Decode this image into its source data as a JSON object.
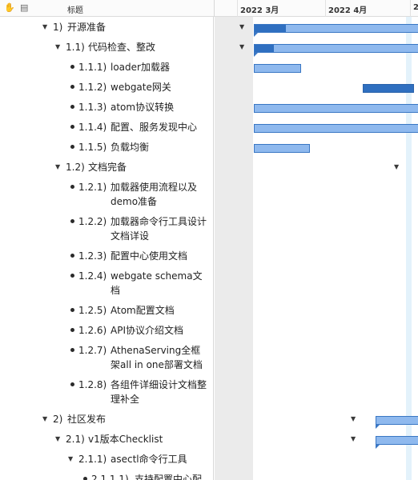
{
  "header": {
    "title_column": "标题",
    "months": [
      "2022 3月",
      "2022 4月",
      "2"
    ],
    "icons": [
      "hand-icon",
      "document-icon"
    ]
  },
  "colors": {
    "bar_fill": "#8fb9ee",
    "bar_progress": "#2f6fc0",
    "today_line": "#e3f2fb"
  },
  "rows": [
    {
      "level": 1,
      "marker": "triangle",
      "num": "1)",
      "text": "开源准备",
      "chart": {
        "type": "summary",
        "start": 0.0,
        "end": 1.1,
        "progress": 0.16
      }
    },
    {
      "level": 2,
      "marker": "triangle",
      "num": "1.1)",
      "text": "代码检查、整改",
      "chart": {
        "type": "summary",
        "start": 0.0,
        "end": 1.1,
        "progress": 0.1
      }
    },
    {
      "level": 3,
      "marker": "bullet",
      "num": "1.1.1)",
      "text": "loader加载器",
      "chart": {
        "type": "bar",
        "start": 0.0,
        "end": 0.27,
        "progress": 0
      }
    },
    {
      "level": 3,
      "marker": "bullet",
      "num": "1.1.2)",
      "text": "webgate网关",
      "chart": {
        "type": "bar",
        "start": 0.62,
        "end": 0.91,
        "progress": 1
      }
    },
    {
      "level": 3,
      "marker": "bullet",
      "num": "1.1.3)",
      "text": "atom协议转换",
      "chart": {
        "type": "bar",
        "start": 0.0,
        "end": 1.1,
        "progress": 0
      }
    },
    {
      "level": 3,
      "marker": "bullet",
      "num": "1.1.4)",
      "text": "配置、服务发现中心",
      "chart": {
        "type": "bar",
        "start": 0.0,
        "end": 1.1,
        "progress": 0
      }
    },
    {
      "level": 3,
      "marker": "bullet",
      "num": "1.1.5)",
      "text": "负载均衡",
      "chart": {
        "type": "bar",
        "start": 0.0,
        "end": 0.32,
        "progress": 0
      }
    },
    {
      "level": 2,
      "marker": "triangle",
      "num": "1.2)",
      "text": "文档完备",
      "chart": {
        "type": "summary",
        "start": 0.93,
        "end": 1.1,
        "progress": 0
      }
    },
    {
      "level": 3,
      "marker": "bullet",
      "num": "1.2.1)",
      "text": "加载器使用流程以及demo准备",
      "chart": {
        "type": "bar",
        "start": 0.93,
        "end": 1.1,
        "progress": 0
      }
    },
    {
      "level": 3,
      "marker": "bullet",
      "num": "1.2.2)",
      "text": "加载器命令行工具设计文档详设",
      "chart": {
        "type": "bar",
        "start": 0.93,
        "end": 1.1,
        "progress": 0
      }
    },
    {
      "level": 3,
      "marker": "bullet",
      "num": "1.2.3)",
      "text": "配置中心使用文档",
      "chart": {
        "type": "empty",
        "start": 0.93,
        "end": 1.1,
        "progress": 0
      }
    },
    {
      "level": 3,
      "marker": "bullet",
      "num": "1.2.4)",
      "text": "webgate schema文档",
      "chart": {
        "type": "empty",
        "start": 0.93,
        "end": 1.1,
        "progress": 0
      }
    },
    {
      "level": 3,
      "marker": "bullet",
      "num": "1.2.5)",
      "text": "Atom配置文档",
      "chart": {
        "type": "empty",
        "start": 0.93,
        "end": 1.1,
        "progress": 0
      }
    },
    {
      "level": 3,
      "marker": "bullet",
      "num": "1.2.6)",
      "text": "API协议介绍文档",
      "chart": {
        "type": "bar",
        "start": 0.93,
        "end": 0.97,
        "progress": 0
      }
    },
    {
      "level": 3,
      "marker": "bullet",
      "num": "1.2.7)",
      "text": "AthenaServing全框架all in one部署文档",
      "chart": {
        "type": "bar",
        "start": 0.93,
        "end": 0.97,
        "progress": 0
      }
    },
    {
      "level": 3,
      "marker": "bullet",
      "num": "1.2.8)",
      "text": "各组件详细设计文档整理补全",
      "chart": {
        "type": "empty",
        "start": 0.93,
        "end": 1.1,
        "progress": 0
      }
    },
    {
      "level": 1,
      "marker": "triangle",
      "num": "2)",
      "text": "社区发布",
      "chart": {
        "type": "summary",
        "start": 0.69,
        "end": 1.1,
        "progress": 0
      }
    },
    {
      "level": 2,
      "marker": "triangle",
      "num": "2.1)",
      "text": "v1版本Checklist",
      "chart": {
        "type": "summary",
        "start": 0.69,
        "end": 1.1,
        "progress": 0
      }
    },
    {
      "level": 3,
      "marker": "triangle",
      "num": "2.1.1)",
      "text": "asectl命令行工具",
      "chart": {
        "type": "empty",
        "start": 0.93,
        "end": 1.1,
        "progress": 0
      }
    },
    {
      "level": 4,
      "marker": "bullet",
      "num": "2.1.1.1)",
      "text": "支持配置中心配置",
      "chart": {
        "type": "empty",
        "start": 0.93,
        "end": 1.1,
        "progress": 0
      }
    }
  ]
}
